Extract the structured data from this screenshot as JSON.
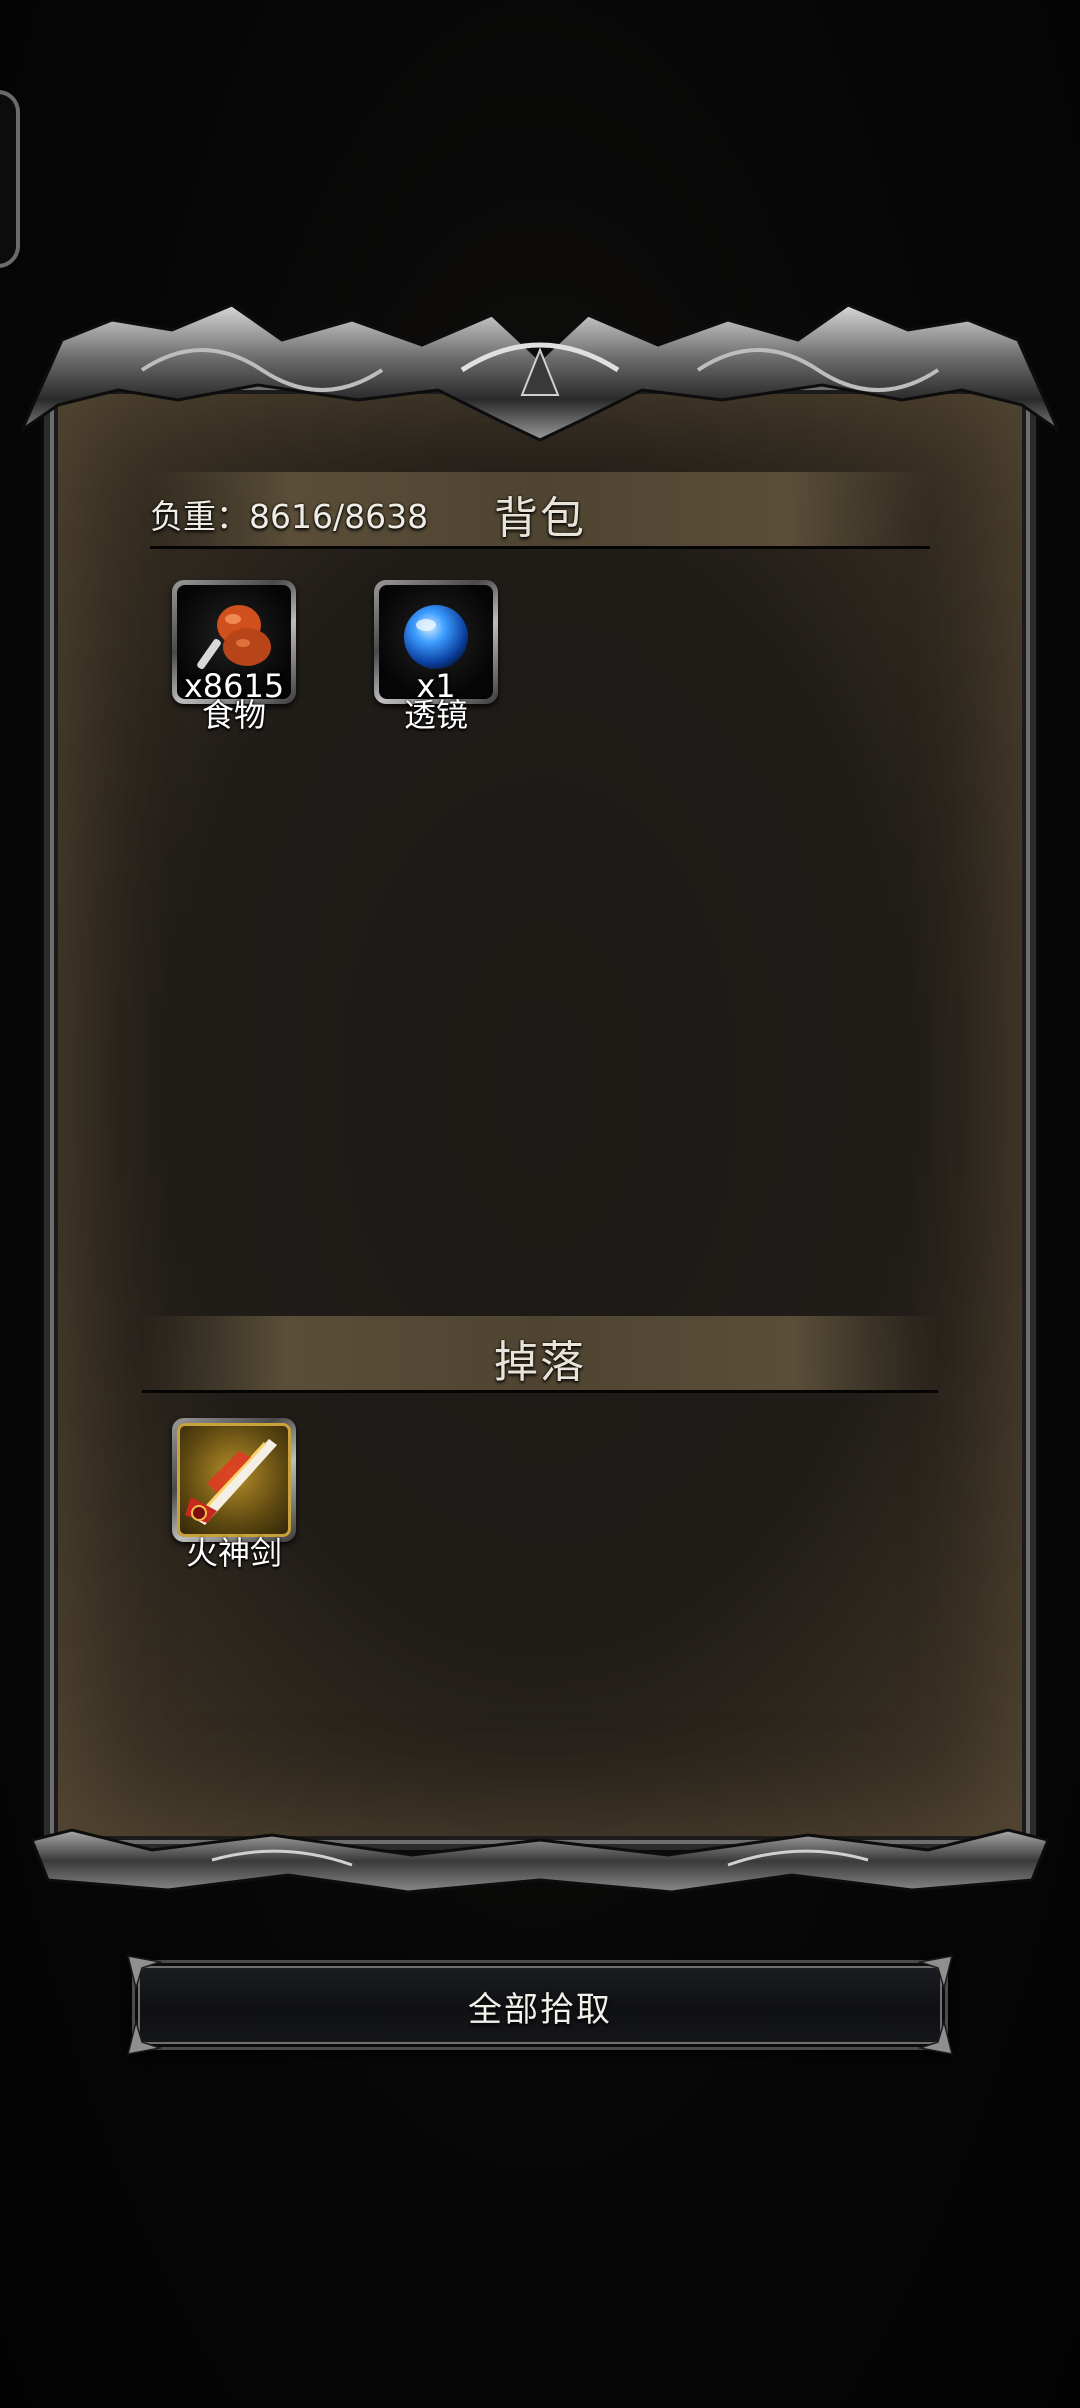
{
  "backpack": {
    "title": "背包",
    "weight_label": "负重：8616/8638",
    "items": [
      {
        "name": "食物",
        "quantity": "x8615",
        "icon": "roast-meat-icon"
      },
      {
        "name": "透镜",
        "quantity": "x1",
        "icon": "blue-orb-icon"
      }
    ]
  },
  "drops": {
    "title": "掉落",
    "items": [
      {
        "name": "火神剑",
        "icon": "fire-sword-icon"
      }
    ]
  },
  "actions": {
    "pickup_all_label": "全部拾取"
  },
  "colors": {
    "header_band": "#5a4e38",
    "panel_background": "#201c18",
    "text": "#ffffff"
  }
}
